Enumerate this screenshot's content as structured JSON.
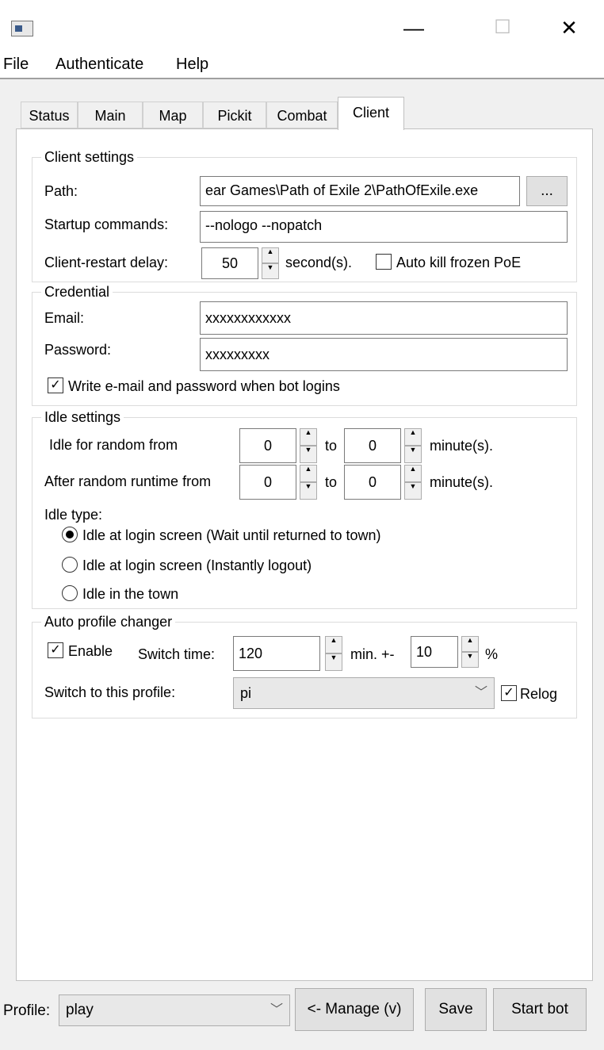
{
  "window": {
    "minimize_glyph": "—",
    "maximize_glyph": "☐",
    "close_glyph": "✕",
    "icon": "app-icon"
  },
  "menu": [
    "File",
    "Authenticate",
    "Help"
  ],
  "tabs": [
    "Status",
    "Main",
    "Map",
    "Pickit",
    "Combat",
    "Client"
  ],
  "active_tab": "Client",
  "client_settings": {
    "title": "Client settings",
    "path_label": "Path:",
    "path_value": "ear Games\\Path of Exile 2\\PathOfExile.exe",
    "browse_label": "...",
    "startup_label": "Startup commands:",
    "startup_value": "--nologo --nopatch",
    "restart_label": "Client-restart delay:",
    "restart_value": "50",
    "restart_unit": "second(s).",
    "autokill_label": "Auto kill frozen PoE",
    "autokill_checked": false
  },
  "credential": {
    "title": "Credential",
    "email_label": "Email:",
    "email_value": "xxxxxxxxxxxx",
    "password_label": "Password:",
    "password_value": "xxxxxxxxx",
    "write_label": "Write e-mail and password when bot logins",
    "write_checked": true
  },
  "idle": {
    "title": "Idle settings",
    "random_label": "Idle for random from",
    "random_from": "0",
    "random_to": "0",
    "runtime_label": "After random runtime from",
    "runtime_from": "0",
    "runtime_to": "0",
    "to_label": "to",
    "unit": "minute(s).",
    "type_label": "Idle type:",
    "options": [
      "Idle at login screen (Wait until returned to town)",
      "Idle at login screen (Instantly logout)",
      "Idle in the town"
    ],
    "selected_option": 0
  },
  "auto_profile": {
    "title": "Auto profile changer",
    "enable_label": "Enable",
    "enable_checked": true,
    "switch_time_label": "Switch time:",
    "switch_time_value": "120",
    "min_label": "min. +-",
    "percent_value": "10",
    "percent_label": "%",
    "profile_label": "Switch to this profile:",
    "profile_value": "pi",
    "relog_label": "Relog",
    "relog_checked": true
  },
  "footer": {
    "profile_label": "Profile:",
    "profile_value": "play",
    "manage_label": "<- Manage (v)",
    "save_label": "Save",
    "start_label": "Start bot"
  }
}
